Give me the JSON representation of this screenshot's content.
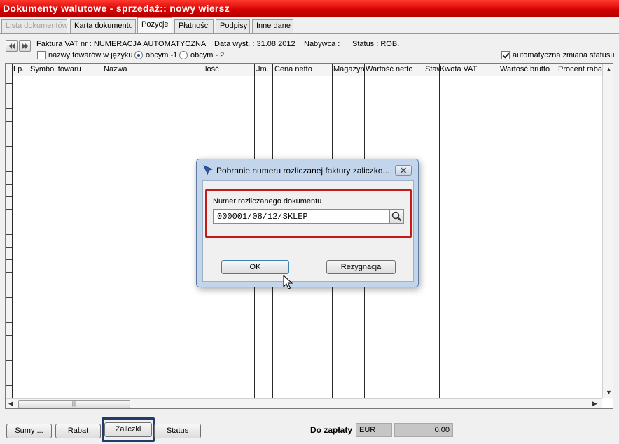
{
  "window": {
    "title": "Dokumenty walutowe - sprzedaż:: nowy wiersz"
  },
  "tabs": [
    {
      "label": "Lista dokumentów",
      "state": "disabled"
    },
    {
      "label": "Karta dokumentu",
      "state": "normal"
    },
    {
      "label": "Pozycje",
      "state": "active"
    },
    {
      "label": "Płatności",
      "state": "normal"
    },
    {
      "label": "Podpisy",
      "state": "normal"
    },
    {
      "label": "Inne dane",
      "state": "normal"
    }
  ],
  "header": {
    "invoice": "Faktura VAT nr : NUMERACJA AUTOMATYCZNA",
    "date": "Data wyst. : 31.08.2012",
    "buyer": "Nabywca :",
    "status": "Status : ROB.",
    "option_foreign_names": "nazwy towarów w języku",
    "radio_1": "obcym -1",
    "radio_2": "obcym - 2",
    "auto_status": "automatyczna zmiana statusu"
  },
  "grid": {
    "columns": [
      "Lp.",
      "Symbol towaru",
      "Nazwa",
      "Ilość",
      "Jm.",
      "Cena netto",
      "Magazyn",
      "Wartość netto",
      "Staw",
      "Kwota VAT",
      "Wartość brutto",
      "Procent raba"
    ]
  },
  "dialog": {
    "title": "Pobranie numeru rozliczanej faktury zaliczko...",
    "field_label": "Numer rozliczanego dokumentu",
    "field_value": "000001/08/12/SKLEP",
    "ok_label": "OK",
    "cancel_label": "Rezygnacja"
  },
  "footer": {
    "sumy_label": "Sumy ...",
    "rabat_label": "Rabat",
    "zaliczki_label": "Zaliczki",
    "status_label": "Status",
    "total_label": "Do zapłaty",
    "currency": "EUR",
    "amount": "0,00"
  },
  "colors": {
    "titlebar": "#d40000",
    "dialog_highlight": "#c41a1a",
    "selected_button_frame": "#1f3d68"
  }
}
